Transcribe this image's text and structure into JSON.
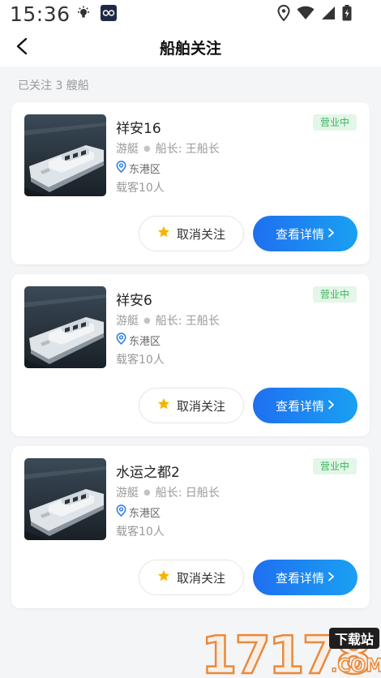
{
  "status_bar": {
    "time": "15:36"
  },
  "header": {
    "title": "船舶关注"
  },
  "follow_count": "已关注 3 艘船",
  "cards": [
    {
      "name": "祥安16",
      "status": "营业中",
      "type": "游艇",
      "captain": "船长: 王船长",
      "location": "东港区",
      "capacity": "载客10人",
      "unfollow_label": "取消关注",
      "detail_label": "查看详情"
    },
    {
      "name": "祥安6",
      "status": "营业中",
      "type": "游艇",
      "captain": "船长: 王船长",
      "location": "东港区",
      "capacity": "载客10人",
      "unfollow_label": "取消关注",
      "detail_label": "查看详情"
    },
    {
      "name": "水运之都2",
      "status": "营业中",
      "type": "游艇",
      "captain": "船长: 日船长",
      "location": "东港区",
      "capacity": "载客10人",
      "unfollow_label": "取消关注",
      "detail_label": "查看详情"
    }
  ],
  "watermark": {
    "number": "17178",
    "site": "下载站",
    "domain": ".COM"
  },
  "colors": {
    "primary_gradient_start": "#1f6ff0",
    "primary_gradient_end": "#1aa0f2",
    "status_green": "#3bb55a",
    "status_green_bg": "#e3f6e8",
    "star": "#f5b400",
    "location_icon": "#2a7be4"
  }
}
